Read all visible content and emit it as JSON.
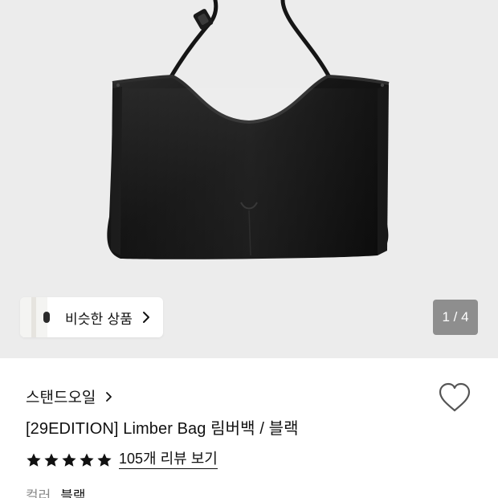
{
  "gallery": {
    "similar_label": "비슷한 상품",
    "counter": "1 / 4",
    "background_color": "#ececec",
    "image_alt": "Limber Bag black leather tote"
  },
  "product": {
    "brand": "스탠드오일",
    "title": "[29EDITION] Limber Bag 림버백 / 블랙",
    "rating_stars": 5,
    "review_link": "105개 리뷰 보기",
    "option_label": "컬러",
    "option_value": "블랙"
  },
  "icons": {
    "similar_chevron": "chevron-right-icon",
    "brand_chevron": "chevron-right-icon",
    "wishlist": "heart-outline-icon",
    "star": "star-filled-icon"
  },
  "colors": {
    "text": "#111111",
    "muted": "#8a8a8a",
    "counter_bg": "#696969"
  }
}
